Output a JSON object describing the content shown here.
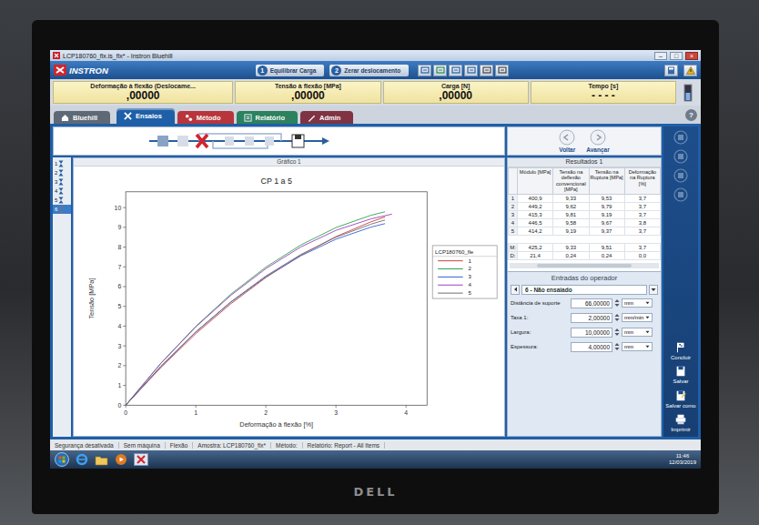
{
  "monitor": {
    "brand": "DELL"
  },
  "window": {
    "title": "LCP180760_flx.is_flx* - Instron Bluehill",
    "controls": [
      "–",
      "□",
      "×"
    ]
  },
  "header": {
    "logo": "INSTRON",
    "actions": [
      {
        "number": "1",
        "label": "Equilibrar Carga"
      },
      {
        "number": "2",
        "label": "Zerar deslocamento"
      }
    ]
  },
  "readouts": [
    {
      "label": "Deformação à flexão (Deslocame...",
      "value": ",00000"
    },
    {
      "label": "Tensão à flexão [MPa]",
      "value": ",00000"
    },
    {
      "label": "Carga [N]",
      "value": ",00000"
    },
    {
      "label": "Tempo [s]",
      "value": "- - - -"
    }
  ],
  "tabs": [
    {
      "label": "Bluehill",
      "selected": false,
      "color": "#55606d"
    },
    {
      "label": "Ensaios",
      "selected": true,
      "color": "#1f5fa8"
    },
    {
      "label": "Método",
      "selected": false,
      "color": "#b8282f"
    },
    {
      "label": "Relatório",
      "selected": false,
      "color": "#1f7a55"
    },
    {
      "label": "Admin",
      "selected": false,
      "color": "#7a2636"
    }
  ],
  "help": "?",
  "workflow": {
    "nav": [
      {
        "label": "Voltar"
      },
      {
        "label": "Avançar"
      }
    ]
  },
  "specimens": [
    {
      "label": "1",
      "tested": true,
      "selected": false
    },
    {
      "label": "2",
      "tested": true,
      "selected": false
    },
    {
      "label": "3",
      "tested": true,
      "selected": false
    },
    {
      "label": "4",
      "tested": true,
      "selected": false
    },
    {
      "label": "5",
      "tested": true,
      "selected": false
    },
    {
      "label": "6",
      "tested": false,
      "selected": true
    }
  ],
  "chart": {
    "panel_title": "Gráfico 1",
    "title": "CP 1 a 5",
    "y_label": "Tensão [MPa]",
    "x_label": "Deformação à flexão [%]",
    "y_ticks": [
      "0",
      "1",
      "2",
      "3",
      "4",
      "5",
      "6",
      "7",
      "8",
      "9",
      "10"
    ],
    "x_ticks": [
      "0",
      "1",
      "2",
      "3",
      "4"
    ],
    "legend_title": "LCP180760_fle",
    "series": [
      {
        "name": "1",
        "color": "#d23a3a",
        "x": [
          0,
          0.5,
          1,
          1.5,
          2,
          2.5,
          3,
          3.5,
          3.7
        ],
        "y": [
          0,
          1.9,
          3.62,
          5.13,
          6.46,
          7.59,
          8.53,
          9.28,
          9.53
        ]
      },
      {
        "name": "2",
        "color": "#2e9e4f",
        "x": [
          0,
          0.5,
          1,
          1.5,
          2,
          2.5,
          3,
          3.5,
          3.7
        ],
        "y": [
          0,
          2.12,
          3.99,
          5.62,
          6.99,
          8.11,
          8.99,
          9.61,
          9.79
        ]
      },
      {
        "name": "3",
        "color": "#2f5fd0",
        "x": [
          0,
          0.5,
          1,
          1.5,
          2,
          2.5,
          3,
          3.5,
          3.7
        ],
        "y": [
          0,
          1.96,
          3.7,
          5.21,
          6.5,
          7.56,
          8.4,
          9.01,
          9.19
        ]
      },
      {
        "name": "4",
        "color": "#9b3fb8",
        "x": [
          0,
          0.5,
          1,
          1.5,
          2,
          2.5,
          3,
          3.5,
          3.8
        ],
        "y": [
          0,
          2.11,
          3.96,
          5.56,
          6.91,
          8.01,
          8.85,
          9.43,
          9.67
        ]
      },
      {
        "name": "5",
        "color": "#6d6d6d",
        "x": [
          0,
          0.5,
          1,
          1.5,
          2,
          2.5,
          3,
          3.5,
          3.7
        ],
        "y": [
          0,
          1.96,
          3.71,
          5.23,
          6.54,
          7.63,
          8.5,
          9.16,
          9.37
        ]
      }
    ]
  },
  "results": {
    "title": "Resultados 1",
    "columns": [
      "Módulo [MPa]",
      "Tensão na deflexão convencional [MPa]",
      "Tensão na Ruptura [MPa]",
      "Deformação na Ruptura [%]"
    ],
    "rows": [
      [
        "1",
        "400,9",
        "9,33",
        "9,53",
        "3,7"
      ],
      [
        "2",
        "449,2",
        "9,62",
        "9,79",
        "3,7"
      ],
      [
        "3",
        "415,3",
        "9,81",
        "9,19",
        "3,7"
      ],
      [
        "4",
        "446,5",
        "9,58",
        "9,67",
        "3,8"
      ],
      [
        "5",
        "414,2",
        "9,19",
        "9,37",
        "3,7"
      ]
    ],
    "stats": [
      [
        "M:",
        "425,2",
        "9,33",
        "9,51",
        "3,7"
      ],
      [
        "D:",
        "21,4",
        "0,24",
        "0,24",
        "0,0"
      ]
    ]
  },
  "operator_inputs": {
    "title": "Entradas do operador",
    "specimen": "6 - Não ensaiado",
    "fields": [
      {
        "label": "Distância de suporte",
        "value": "66,00000",
        "unit": "mm"
      },
      {
        "label": "Taxa 1:",
        "value": "2,00000",
        "unit": "mm/min"
      },
      {
        "label": "Largura:",
        "value": "10,00000",
        "unit": "mm"
      },
      {
        "label": "Espessura:",
        "value": "4,00000",
        "unit": "mm"
      }
    ]
  },
  "side_buttons": [
    {
      "label": "Concluir"
    },
    {
      "label": "Salvar"
    },
    {
      "label": "Salvar como"
    },
    {
      "label": "Imprimir"
    }
  ],
  "status_bar": [
    "Segurança desativada",
    "Sem máquina",
    "Flexão",
    "Amostra: LCP180760_flx*",
    "Método:",
    "Relatório: Report - All Items"
  ],
  "taskbar": {
    "time": "11:46",
    "date": "12/03/2019"
  }
}
